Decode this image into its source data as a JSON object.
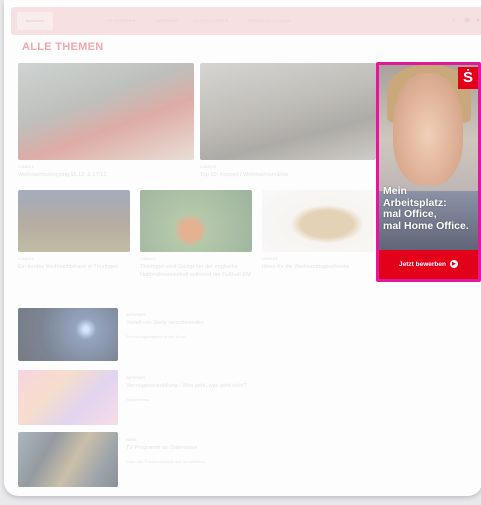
{
  "header": {
    "logo_text": "sparkasse",
    "nav": [
      {
        "label": "TOP THEMEN",
        "has_chevron": true
      },
      {
        "label": "WERBUNG",
        "has_chevron": false
      },
      {
        "label": "NACHRICHTEN",
        "has_chevron": true
      },
      {
        "label": "VERANSTALTUNGEN",
        "has_chevron": false
      }
    ],
    "icons": [
      "search-icon",
      "chat-icon",
      "user-icon"
    ]
  },
  "page_title": "ALLE THEMEN",
  "articles_row1": [
    {
      "kicker": "LOKALES",
      "title": "Weihnachtsshopping 16.12. & 17.12."
    },
    {
      "kicker": "LOKALES",
      "title": "Top 10: Konzert / Weihnachtsmärkte"
    }
  ],
  "articles_row2": [
    {
      "kicker": "LOKALES",
      "title": "Ein buntes Weihnachtshaus in Thüringen"
    },
    {
      "kicker": "LOKALES",
      "title": "Thüringen wird Gastgeber der englische Nationalmannschaft während der Fußball-EM"
    },
    {
      "kicker": "LOKALES",
      "title": "Ideen für die Weihnachtsgeschenke"
    }
  ],
  "articles_list": [
    {
      "kicker": "RATGEBER",
      "title": "Vorteil von Stelly verschwenden",
      "desc": "Einrichtungsratgeber große Kunst"
    },
    {
      "kicker": "RATGEBER",
      "title": "Vermögensverteilung - Was geht, was geht nicht?",
      "desc": "Ratgeberfrau"
    },
    {
      "kicker": "NEWS",
      "title": "TV Programm als Datenware",
      "desc": "Daten der Rundfunkanstalt und Sendeketten"
    }
  ],
  "ad": {
    "brand_symbol": "Ṡ",
    "headline_lines": [
      "Mein",
      "Arbeitsplatz:",
      "mal Office,",
      "mal Home Office."
    ],
    "cta": "Jetzt bewerben",
    "border_color": "#e0189a",
    "brand_color": "#e3001b"
  }
}
